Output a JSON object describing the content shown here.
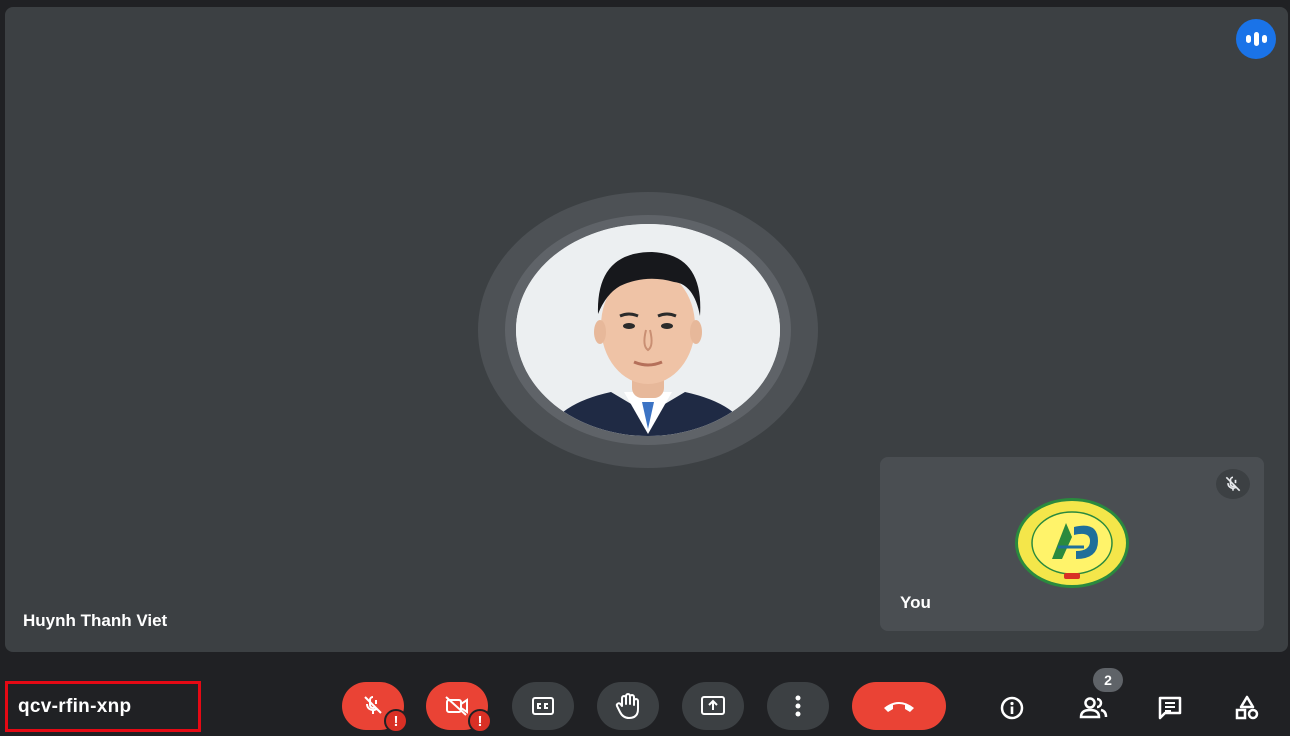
{
  "main_speaker": {
    "name": "Huynh Thanh Viet",
    "avatar_icon": "person-photo"
  },
  "self_tile": {
    "name": "You",
    "logo_icon": "school-logo-icon",
    "mic_state_icon": "mic-off-icon"
  },
  "meeting": {
    "code": "qcv-rfin-xnp"
  },
  "controls": {
    "mic": {
      "icon": "mic-off-icon",
      "state": "off",
      "warning": "!"
    },
    "camera": {
      "icon": "camera-off-icon",
      "state": "off",
      "warning": "!"
    },
    "captions": {
      "icon": "closed-captions-icon"
    },
    "raise_hand": {
      "icon": "hand-icon"
    },
    "present": {
      "icon": "present-screen-icon"
    },
    "more": {
      "icon": "more-vert-icon"
    },
    "leave": {
      "icon": "end-call-icon"
    }
  },
  "side_controls": {
    "info": {
      "icon": "info-icon"
    },
    "people": {
      "icon": "people-icon",
      "count": "2"
    },
    "chat": {
      "icon": "chat-icon"
    },
    "activities": {
      "icon": "activities-icon"
    }
  },
  "colors": {
    "background": "#202124",
    "tile": "#3c4043",
    "danger": "#ea4335",
    "accent": "#1a73e8",
    "highlight_box": "#e50914"
  }
}
